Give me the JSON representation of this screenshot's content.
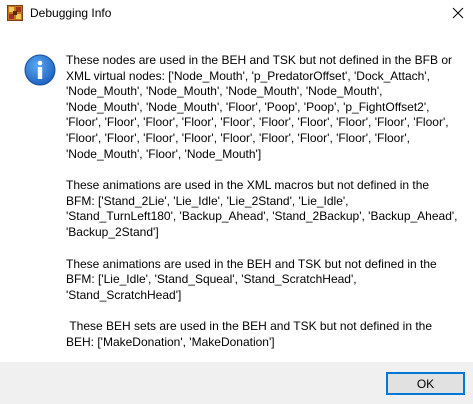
{
  "window": {
    "title": "Debugging Info",
    "app_icon": "app-icon",
    "close_icon": "close-icon"
  },
  "dialog": {
    "icon": "info-icon",
    "message_paragraphs": [
      "These nodes are used in the BEH and TSK but not defined in the BFB or XML virtual nodes: ['Node_Mouth', 'p_PredatorOffset', 'Dock_Attach', 'Node_Mouth', 'Node_Mouth', 'Node_Mouth', 'Node_Mouth', 'Node_Mouth', 'Node_Mouth', 'Floor', 'Poop', 'Poop', 'p_FightOffset2', 'Floor', 'Floor', 'Floor', 'Floor', 'Floor', 'Floor', 'Floor', 'Floor', 'Floor', 'Floor', 'Floor', 'Floor', 'Floor', 'Floor', 'Floor', 'Floor', 'Floor', 'Floor', 'Floor', 'Node_Mouth', 'Floor', 'Node_Mouth']",
      "These animations are used in the XML macros but not defined in the BFM: ['Stand_2Lie', 'Lie_Idle', 'Lie_2Stand', 'Lie_Idle', 'Stand_TurnLeft180', 'Backup_Ahead', 'Stand_2Backup', 'Backup_Ahead', 'Backup_2Stand']",
      "These animations are used in the BEH and TSK but not defined in the BFM: ['Lie_Idle', 'Stand_Squeal', 'Stand_ScratchHead', 'Stand_ScratchHead']",
      " These BEH sets are used in the BEH and TSK but not defined in the BEH: ['MakeDonation', 'MakeDonation']"
    ]
  },
  "footer": {
    "ok_label": "OK"
  }
}
